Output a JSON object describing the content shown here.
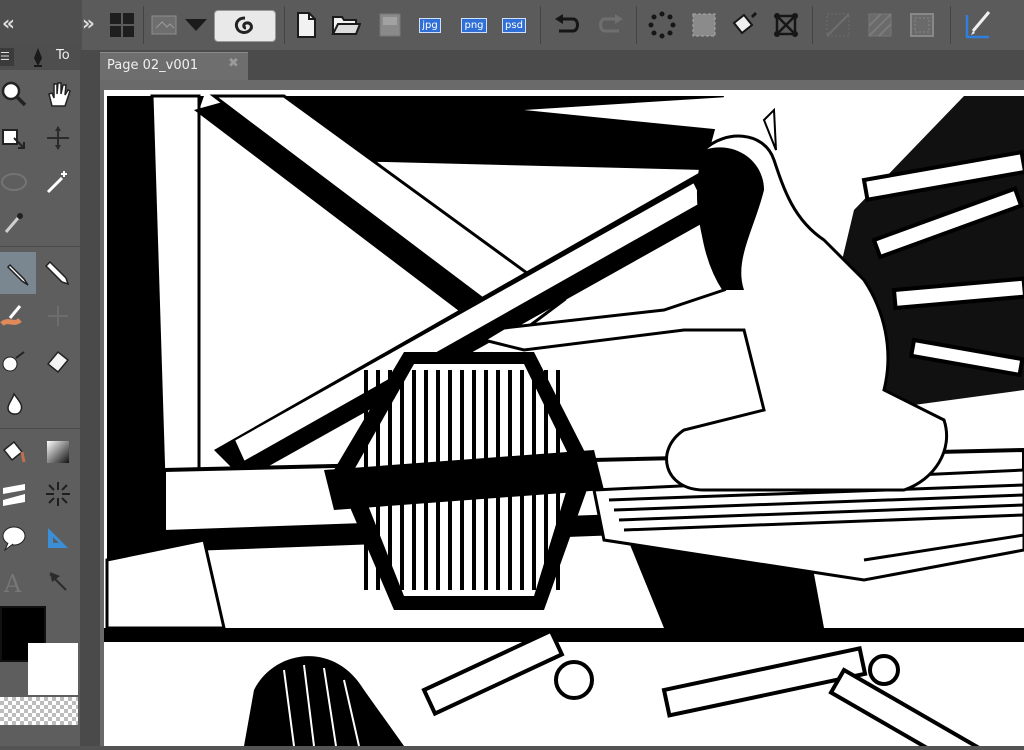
{
  "window": {
    "collapse_left_glyph": "«",
    "collapse_right_glyph": "»"
  },
  "toolbar": {
    "icons": [
      "layout-icon",
      "canvas-icon",
      "dropdown-icon",
      "cloud-icon",
      "new-file-icon",
      "open-folder-icon",
      "save-icon",
      "export-jpg",
      "export-png",
      "export-psd",
      "undo-icon",
      "redo-icon",
      "transform-icon",
      "selection-icon",
      "fill-icon",
      "mesh-icon",
      "ruler-icon",
      "pattern-icon",
      "frame-icon",
      "pen-stylus-icon"
    ],
    "export_jpg_label": "jpg",
    "export_png_label": "png",
    "export_psd_label": "psd"
  },
  "panel": {
    "tab_label": "To",
    "tools": [
      "zoom",
      "hand",
      "layer-move",
      "object-move",
      "lasso-select",
      "magic-wand",
      "eyedropper",
      "pen",
      "pencil",
      "brush",
      "airbrush",
      "eraser",
      "blend",
      "fill",
      "gradient",
      "figure",
      "frame-border",
      "balloon",
      "ruler",
      "text",
      "correct-line"
    ]
  },
  "document": {
    "tab_title": "Page 02_v001",
    "close_glyph": "✖"
  },
  "colors": {
    "main_color": "#000000",
    "sub_color": "#ffffff",
    "transparent": "checker"
  }
}
